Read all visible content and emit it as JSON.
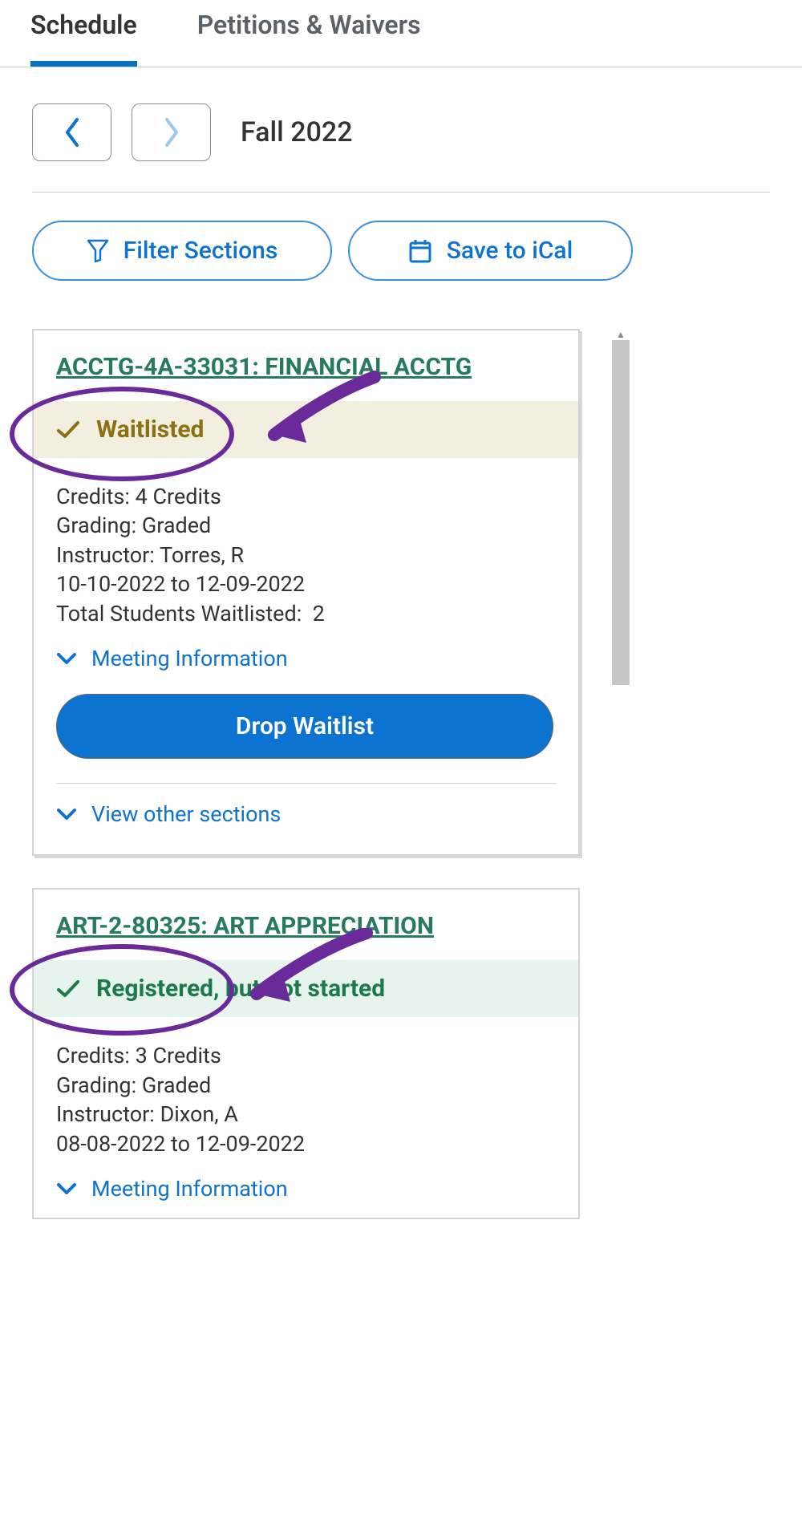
{
  "tabs": {
    "schedule": "Schedule",
    "petitions": "Petitions & Waivers"
  },
  "term": "Fall 2022",
  "actions": {
    "filter": "Filter Sections",
    "ical": "Save to iCal"
  },
  "labels": {
    "credits": "Credits:",
    "grading": "Grading:",
    "instructor": "Instructor:",
    "dates_to": "to",
    "waitlisted_total": "Total Students Waitlisted:",
    "meeting_info": "Meeting Information",
    "view_other": "View other sections",
    "drop_waitlist": "Drop Waitlist"
  },
  "courses": [
    {
      "title": "ACCTG-4A-33031: FINANCIAL ACCTG",
      "status_key": "waitlisted",
      "status": "Waitlisted",
      "credits": "4 Credits",
      "grading": "Graded",
      "instructor": "Torres, R",
      "date_start": "10-10-2022",
      "date_end": "12-09-2022",
      "waitlisted_count": "2"
    },
    {
      "title": "ART-2-80325: ART APPRECIATION",
      "status_key": "registered",
      "status": "Registered, but not started",
      "credits": "3 Credits",
      "grading": "Graded",
      "instructor": "Dixon, A",
      "date_start": "08-08-2022",
      "date_end": "12-09-2022"
    }
  ],
  "colors": {
    "primary": "#0d73d0",
    "tab_active": "#0571c0",
    "waitlisted_bg": "#f3efe0",
    "waitlisted_fg": "#8c7011",
    "registered_bg": "#e7f3ed",
    "registered_fg": "#1b7a4b",
    "annotation": "#6b2a9a"
  }
}
